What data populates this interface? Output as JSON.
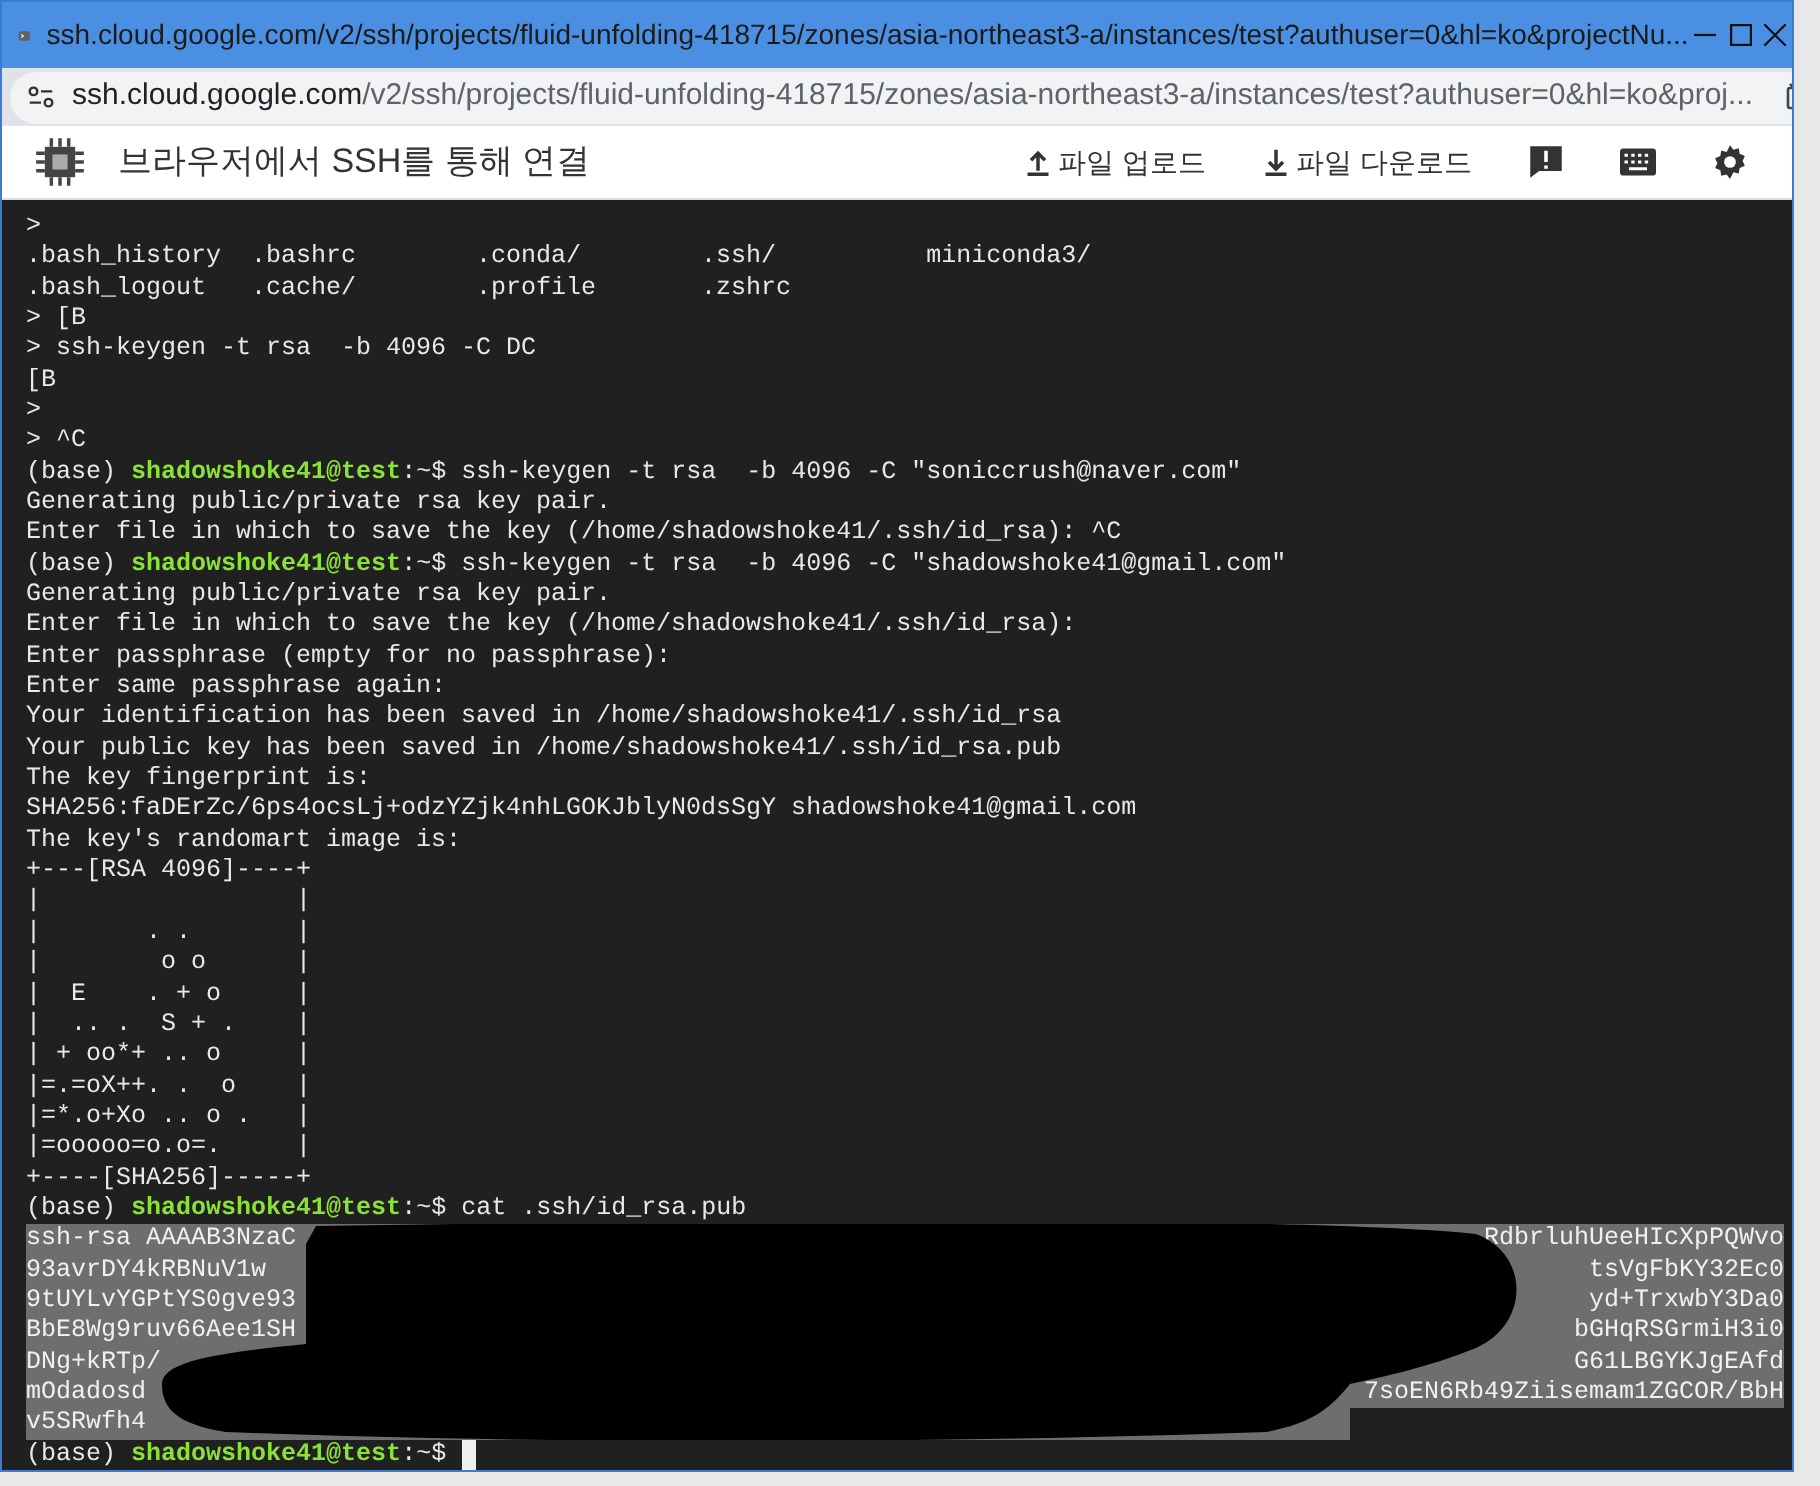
{
  "window": {
    "title": "ssh.cloud.google.com/v2/ssh/projects/fluid-unfolding-418715/zones/asia-northeast3-a/instances/test?authuser=0&hl=ko&projectNu..."
  },
  "address_bar": {
    "domain": "ssh.cloud.google.com",
    "path": "/v2/ssh/projects/fluid-unfolding-418715/zones/asia-northeast3-a/instances/test?authuser=0&hl=ko&proj..."
  },
  "toolbar": {
    "title": "브라우저에서 SSH를 통해 연결",
    "actions": [
      {
        "kind": "upload",
        "label": "파일 업로드"
      },
      {
        "kind": "download",
        "label": "파일 다운로드"
      },
      {
        "kind": "feedback"
      },
      {
        "kind": "keyboard"
      },
      {
        "kind": "settings"
      }
    ]
  },
  "terminal": {
    "lines": [
      {
        "kind": "text",
        "text": ">"
      },
      {
        "kind": "text",
        "text": ".bash_history  .bashrc        .conda/        .ssh/          miniconda3/"
      },
      {
        "kind": "text",
        "text": ".bash_logout   .cache/        .profile       .zshrc"
      },
      {
        "kind": "text",
        "text": "> [B"
      },
      {
        "kind": "text",
        "text": "> ssh-keygen -t rsa  -b 4096 -C DC"
      },
      {
        "kind": "text",
        "text": "[B"
      },
      {
        "kind": "text",
        "text": ">"
      },
      {
        "kind": "text",
        "text": "> ^C"
      },
      {
        "kind": "prompt",
        "env": "(base)",
        "user_host": "shadowshoke41@test",
        "path": ":~$",
        "command": "ssh-keygen -t rsa  -b 4096 -C \"soniccrush@naver.com\""
      },
      {
        "kind": "text",
        "text": "Generating public/private rsa key pair."
      },
      {
        "kind": "text",
        "text": "Enter file in which to save the key (/home/shadowshoke41/.ssh/id_rsa): ^C"
      },
      {
        "kind": "prompt",
        "env": "(base)",
        "user_host": "shadowshoke41@test",
        "path": ":~$",
        "command": "ssh-keygen -t rsa  -b 4096 -C \"shadowshoke41@gmail.com\""
      },
      {
        "kind": "text",
        "text": "Generating public/private rsa key pair."
      },
      {
        "kind": "text",
        "text": "Enter file in which to save the key (/home/shadowshoke41/.ssh/id_rsa):"
      },
      {
        "kind": "text",
        "text": "Enter passphrase (empty for no passphrase):"
      },
      {
        "kind": "text",
        "text": "Enter same passphrase again:"
      },
      {
        "kind": "text",
        "text": "Your identification has been saved in /home/shadowshoke41/.ssh/id_rsa"
      },
      {
        "kind": "text",
        "text": "Your public key has been saved in /home/shadowshoke41/.ssh/id_rsa.pub"
      },
      {
        "kind": "text",
        "text": "The key fingerprint is:"
      },
      {
        "kind": "text",
        "text": "SHA256:faDErZc/6ps4ocsLj+odzYZjk4nhLGOKJblyN0dsSgY shadowshoke41@gmail.com"
      },
      {
        "kind": "text",
        "text": "The key's randomart image is:"
      },
      {
        "kind": "text",
        "text": "+---[RSA 4096]----+"
      },
      {
        "kind": "text",
        "text": "|                 |"
      },
      {
        "kind": "text",
        "text": "|       . .       |"
      },
      {
        "kind": "text",
        "text": "|        o o      |"
      },
      {
        "kind": "text",
        "text": "|  E    . + o     |"
      },
      {
        "kind": "text",
        "text": "|  .. .  S + .    |"
      },
      {
        "kind": "text",
        "text": "| + oo*+ .. o     |"
      },
      {
        "kind": "text",
        "text": "|=.=oX++. .  o    |"
      },
      {
        "kind": "text",
        "text": "|=*.o+Xo .. o .   |"
      },
      {
        "kind": "text",
        "text": "|=ooooo=o.o=.     |"
      },
      {
        "kind": "text",
        "text": "+----[SHA256]-----+"
      },
      {
        "kind": "prompt",
        "env": "(base)",
        "user_host": "shadowshoke41@test",
        "path": ":~$",
        "command": "cat .ssh/id_rsa.pub"
      },
      {
        "kind": "key",
        "selected": true,
        "left": "ssh-rsa AAAAB3NzaC",
        "right": "RdbrluhUeeHIcXpPQWvo"
      },
      {
        "kind": "key",
        "selected": true,
        "left": "93avrDY4kRBNuV1w",
        "right": "tsVgFbKY32Ec0"
      },
      {
        "kind": "key",
        "selected": true,
        "left": "9tUYLvYGPtYS0gve93",
        "right": "yd+TrxwbY3Da0"
      },
      {
        "kind": "key",
        "selected": true,
        "left": "BbE8Wg9ruv66Aee1SH",
        "right": "bGHqRSGrmiH3i0"
      },
      {
        "kind": "key",
        "selected": true,
        "left": "DNg+kRTp/",
        "right": "G61LBGYKJgEAfd"
      },
      {
        "kind": "key",
        "selected": true,
        "left": "mOdadosd",
        "right": "7soEN6Rb49Ziisemam1ZGCOR/BbH"
      },
      {
        "kind": "key_end",
        "selected": true,
        "left": "v5SRwfh4"
      },
      {
        "kind": "prompt",
        "env": "(base)",
        "user_host": "shadowshoke41@test",
        "path": ":~$",
        "cursor": true
      }
    ]
  }
}
